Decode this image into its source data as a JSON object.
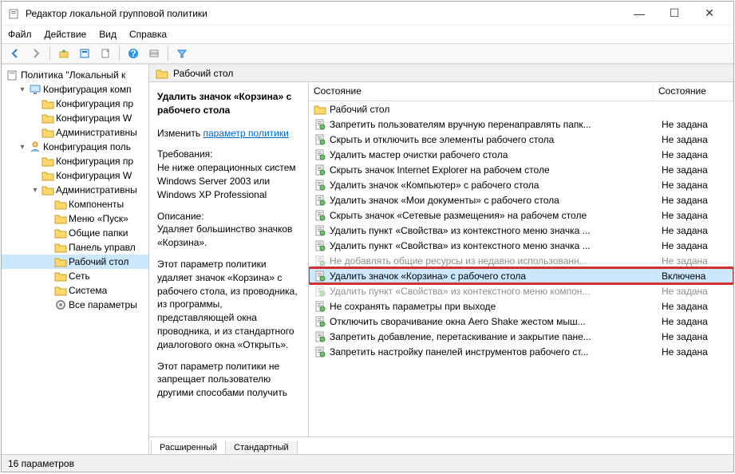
{
  "window": {
    "title": "Редактор локальной групповой политики"
  },
  "menu": [
    "Файл",
    "Действие",
    "Вид",
    "Справка"
  ],
  "tree": {
    "root": "Политика \"Локальный к",
    "items": [
      {
        "level": 1,
        "caret": "▾",
        "icon": "comp",
        "label": "Конфигурация комп"
      },
      {
        "level": 2,
        "caret": "",
        "icon": "folder",
        "label": "Конфигурация пр"
      },
      {
        "level": 2,
        "caret": "",
        "icon": "folder",
        "label": "Конфигурация W"
      },
      {
        "level": 2,
        "caret": "",
        "icon": "folder",
        "label": "Административны"
      },
      {
        "level": 1,
        "caret": "▾",
        "icon": "user",
        "label": "Конфигурация поль"
      },
      {
        "level": 2,
        "caret": "",
        "icon": "folder",
        "label": "Конфигурация пр"
      },
      {
        "level": 2,
        "caret": "",
        "icon": "folder",
        "label": "Конфигурация W"
      },
      {
        "level": 2,
        "caret": "▾",
        "icon": "folder",
        "label": "Административны"
      },
      {
        "level": 3,
        "caret": "",
        "icon": "folder",
        "label": "Компоненты"
      },
      {
        "level": 3,
        "caret": "",
        "icon": "folder",
        "label": "Меню «Пуск» "
      },
      {
        "level": 3,
        "caret": "",
        "icon": "folder",
        "label": "Общие папки"
      },
      {
        "level": 3,
        "caret": "",
        "icon": "folder",
        "label": "Панель управл"
      },
      {
        "level": 3,
        "caret": "",
        "icon": "folder",
        "label": "Рабочий стол",
        "selected": true
      },
      {
        "level": 3,
        "caret": "",
        "icon": "folder",
        "label": "Сеть"
      },
      {
        "level": 3,
        "caret": "",
        "icon": "folder",
        "label": "Система"
      },
      {
        "level": 3,
        "caret": "",
        "icon": "settings",
        "label": "Все параметры"
      }
    ]
  },
  "main_header": "Рабочий стол",
  "description": {
    "title": "Удалить значок «Корзина» с рабочего стола",
    "edit_label": "Изменить",
    "edit_link": "параметр политики",
    "req_label": "Требования:",
    "req_text": "Не ниже операционных систем Windows Server 2003 или Windows XP Professional",
    "desc_label": "Описание:",
    "desc_p1": "Удаляет большинство значков «Корзина».",
    "desc_p2": "Этот параметр политики удаляет значок «Корзина» с рабочего стола, из проводника, из программы, представляющей окна проводника, и из стандартного диалогового окна «Открыть».",
    "desc_p3": "Этот параметр политики не запрещает пользователю другими способами получить"
  },
  "columns": {
    "c1": "Состояние",
    "c2": "Состояние"
  },
  "rows": [
    {
      "icon": "folder",
      "label": "Рабочий стол",
      "state": ""
    },
    {
      "icon": "policy",
      "label": "Запретить пользователям вручную перенаправлять папк...",
      "state": "Не задана"
    },
    {
      "icon": "policy",
      "label": "Скрыть и отключить все элементы рабочего стола",
      "state": "Не задана"
    },
    {
      "icon": "policy",
      "label": "Удалить мастер очистки рабочего стола",
      "state": "Не задана"
    },
    {
      "icon": "policy",
      "label": "Скрыть значок Internet Explorer на рабочем столе",
      "state": "Не задана"
    },
    {
      "icon": "policy",
      "label": "Удалить значок «Компьютер» с рабочего стола",
      "state": "Не задана"
    },
    {
      "icon": "policy",
      "label": "Удалить значок «Мои документы» с рабочего стола",
      "state": "Не задана"
    },
    {
      "icon": "policy",
      "label": "Скрыть значок «Сетевые размещения» на рабочем столе",
      "state": "Не задана"
    },
    {
      "icon": "policy",
      "label": "Удалить пункт «Свойства» из контекстного меню значка ...",
      "state": "Не задана"
    },
    {
      "icon": "policy",
      "label": "Удалить пункт «Свойства» из контекстного меню значка ...",
      "state": "Не задана"
    },
    {
      "icon": "policy",
      "label": "Не добавлять общие ресурсы из недавно использованн...",
      "state": "Не задана",
      "faded": true
    },
    {
      "icon": "policy",
      "label": "Удалить значок «Корзина» с рабочего стола",
      "state": "Включена",
      "highlighted": true
    },
    {
      "icon": "policy",
      "label": "Удалить пункт «Свойства» из контекстного меню компон...",
      "state": "Не задана",
      "faded": true
    },
    {
      "icon": "policy",
      "label": "Не сохранять параметры при выходе",
      "state": "Не задана"
    },
    {
      "icon": "policy",
      "label": "Отключить сворачивание окна Aero Shake жестом мыш...",
      "state": "Не задана"
    },
    {
      "icon": "policy",
      "label": "Запретить добавление, перетаскивание и закрытие пане...",
      "state": "Не задана"
    },
    {
      "icon": "policy",
      "label": "Запретить настройку панелей инструментов рабочего ст...",
      "state": "Не задана"
    }
  ],
  "tabs": {
    "extended": "Расширенный",
    "standard": "Стандартный"
  },
  "status": "16 параметров"
}
